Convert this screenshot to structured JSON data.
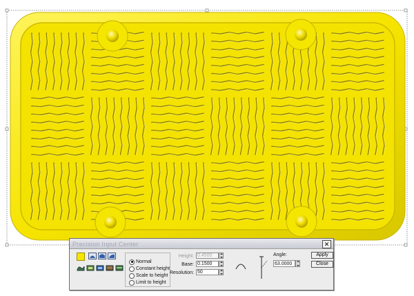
{
  "dialog": {
    "title": "Precision Input Center",
    "close_label": "✕",
    "shape_modes": {
      "options": [
        "Normal",
        "Constant height",
        "Scale to height",
        "Limit to height"
      ],
      "selected": "Normal"
    },
    "height": {
      "label": "Height:",
      "value": "0.4500"
    },
    "base": {
      "label": "Base:",
      "value": "0.1500"
    },
    "resolution": {
      "label": "Resolution:",
      "value": "50"
    },
    "angle": {
      "label": "Angle:",
      "value": "63.0000"
    },
    "apply_label": "Apply",
    "close_button_label": "Close"
  },
  "icons": {
    "toolbar_row1": [
      "color-swatch-icon",
      "dome-icon",
      "arch-icon",
      "slope-icon"
    ],
    "toolbar_row2": [
      "blend-icon",
      "raise-icon",
      "lower-icon",
      "texture-icon",
      "flatten-icon"
    ]
  },
  "colors": {
    "relief_yellow": "#f5e600",
    "relief_shadow": "#d2c100",
    "relief_highlight": "#fff35a"
  }
}
